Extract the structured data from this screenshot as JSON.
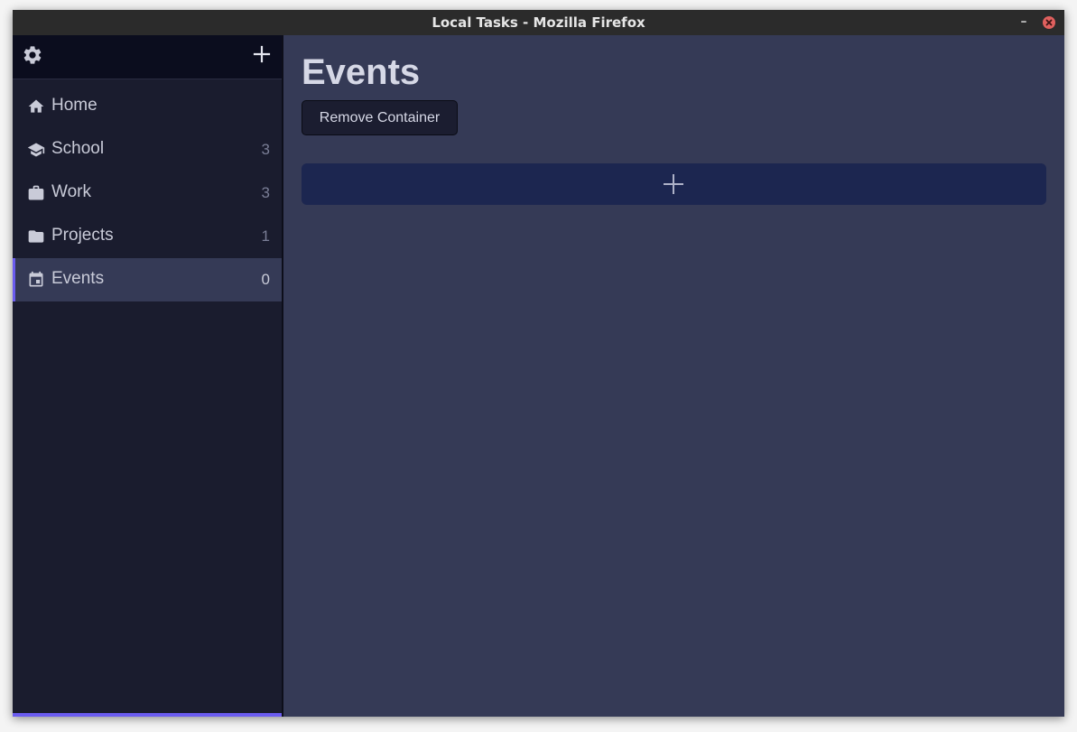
{
  "window": {
    "title": "Local Tasks - Mozilla Firefox",
    "minimize_glyph": "–"
  },
  "sidebar": {
    "settings_icon": "gear-icon",
    "add_icon": "plus-icon",
    "items": [
      {
        "label": "Home",
        "count": "",
        "icon": "home-icon"
      },
      {
        "label": "School",
        "count": "3",
        "icon": "graduation-cap-icon"
      },
      {
        "label": "Work",
        "count": "3",
        "icon": "briefcase-icon"
      },
      {
        "label": "Projects",
        "count": "1",
        "icon": "folder-icon"
      },
      {
        "label": "Events",
        "count": "0",
        "icon": "calendar-icon",
        "active": true
      }
    ]
  },
  "main": {
    "title": "Events",
    "remove_button_label": "Remove Container",
    "add_icon": "plus-icon"
  },
  "colors": {
    "sidebar_bg": "#1a1c2e",
    "sidebar_header_bg": "#0b0d1e",
    "main_bg": "#353a56",
    "active_item_bg": "#353a56",
    "accent": "#6b5cf0",
    "add_bar_bg": "#1c2650",
    "text": "#d6d8e6",
    "muted_count": "#7a7e96",
    "close_button": "#e0605e"
  }
}
